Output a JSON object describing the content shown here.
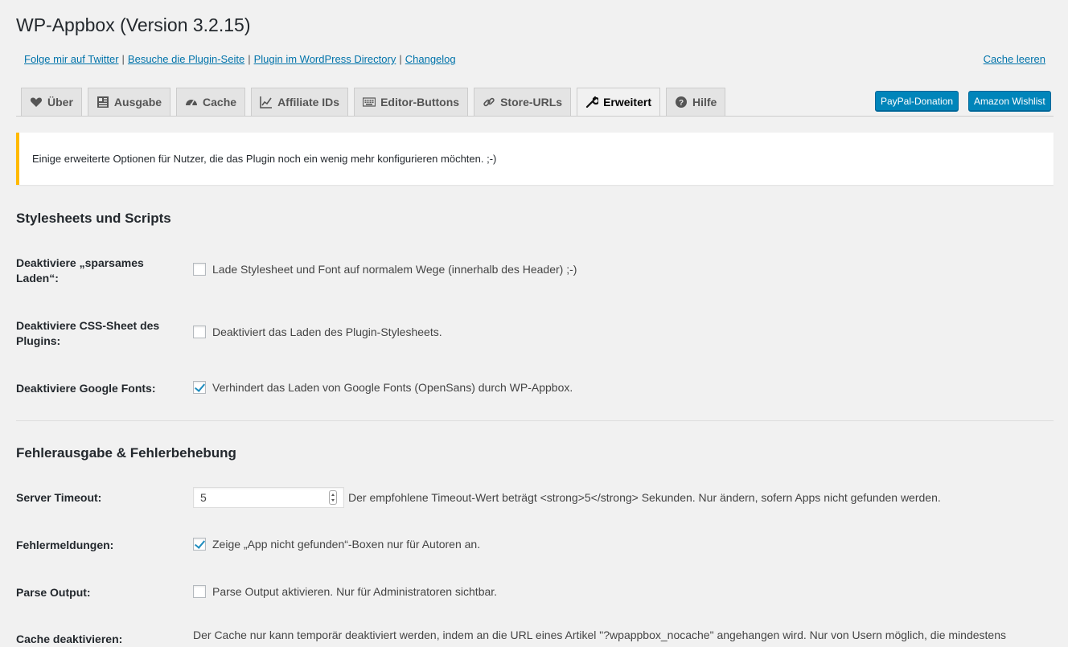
{
  "page": {
    "title": "WP-Appbox (Version 3.2.15)"
  },
  "toplinks": [
    {
      "label": "Folge mir auf Twitter"
    },
    {
      "label": "Besuche die Plugin-Seite"
    },
    {
      "label": "Plugin im WordPress Directory"
    },
    {
      "label": "Changelog"
    }
  ],
  "separator": "|",
  "cache_link": "Cache leeren",
  "tabs": [
    {
      "label": "Über",
      "icon": "heart-icon"
    },
    {
      "label": "Ausgabe",
      "icon": "layout-icon"
    },
    {
      "label": "Cache",
      "icon": "dashboard-icon"
    },
    {
      "label": "Affiliate IDs",
      "icon": "chart-line-icon"
    },
    {
      "label": "Editor-Buttons",
      "icon": "keyboard-icon"
    },
    {
      "label": "Store-URLs",
      "icon": "link-icon"
    },
    {
      "label": "Erweitert",
      "icon": "wrench-icon",
      "active": true
    },
    {
      "label": "Hilfe",
      "icon": "help-icon"
    }
  ],
  "buttons": {
    "paypal": "PayPal-Donation",
    "amazon": "Amazon Wishlist"
  },
  "notice": "Einige erweiterte Optionen für Nutzer, die das Plugin noch ein wenig mehr konfigurieren möchten. ;-)",
  "section1": {
    "title": "Stylesheets und Scripts",
    "rows": [
      {
        "label": "Deaktiviere „sparsames Laden“:",
        "text": "Lade Stylesheet und Font auf normalem Wege (innerhalb des Header) ;-)",
        "checked": false
      },
      {
        "label": "Deaktiviere CSS-Sheet des Plugins:",
        "text": "Deaktiviert das Laden des Plugin-Stylesheets.",
        "checked": false
      },
      {
        "label": "Deaktiviere Google Fonts:",
        "text": "Verhindert das Laden von Google Fonts (OpenSans) durch WP-Appbox.",
        "checked": true
      }
    ]
  },
  "section2": {
    "title": "Fehlerausgabe & Fehlerbehebung",
    "timeout": {
      "label": "Server Timeout:",
      "value": "5",
      "text": "Der empfohlene Timeout-Wert beträgt <strong>5</strong> Sekunden. Nur ändern, sofern Apps nicht gefunden werden."
    },
    "errors": {
      "label": "Fehlermeldungen:",
      "text": "Zeige „App nicht gefunden“-Boxen nur für Autoren an.",
      "checked": true
    },
    "parse": {
      "label": "Parse Output:",
      "text": "Parse Output aktivieren. Nur für Administratoren sichtbar.",
      "checked": false
    },
    "cache": {
      "label": "Cache deaktivieren:",
      "text": "Der Cache nur kann temporär deaktiviert werden, indem an die URL eines Artikel \"?wpappbox_nocache\" angehangen wird. Nur von Usern möglich, die mindestens"
    }
  }
}
